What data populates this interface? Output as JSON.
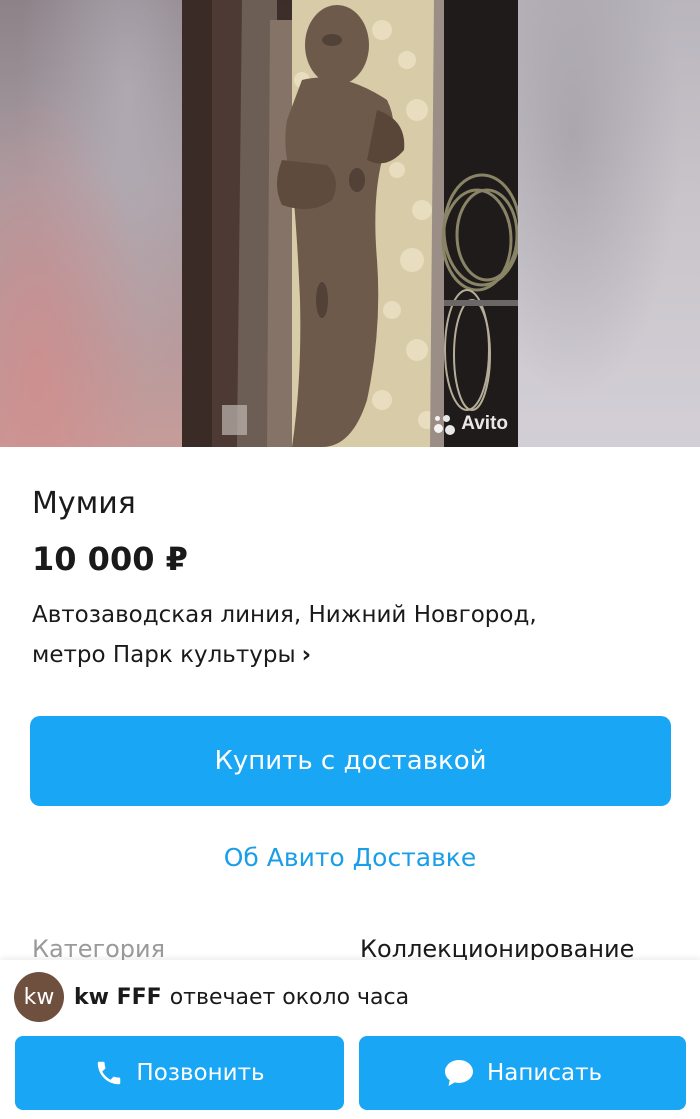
{
  "photo": {
    "watermark_text": "Avito",
    "icon": "avito-logo-icon"
  },
  "listing": {
    "title": "Мумия",
    "price": "10 000 ₽",
    "address_line1": "Автозаводская линия, Нижний Новгород,",
    "address_line2": "метро Парк культуры",
    "address_chevron": "›"
  },
  "actions": {
    "buy_label": "Купить с доставкой",
    "delivery_info_label": "Об Авито Доставке"
  },
  "attributes": [
    {
      "label": "Категория",
      "value": "Коллекционирование"
    }
  ],
  "seller": {
    "avatar_initials": "kw",
    "name": "kw FFF",
    "response_time": "отвечает около часа"
  },
  "bottom_actions": {
    "call_label": "Позвонить",
    "call_icon": "phone-icon",
    "message_label": "Написать",
    "message_icon": "chat-bubble-icon"
  },
  "colors": {
    "accent": "#19a6f4",
    "link": "#1a9ee8",
    "avatar_bg": "#6f4f3e"
  }
}
